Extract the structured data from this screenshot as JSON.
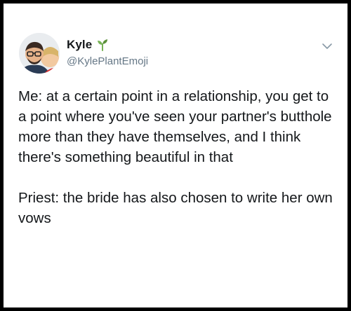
{
  "author": {
    "display_name": "Kyle",
    "handle": "@KylePlantEmoji",
    "verified_badge_icon": "seedling-emoji-icon",
    "avatar_icon": "avatar"
  },
  "menu": {
    "icon": "chevron-down-icon"
  },
  "tweet": {
    "paragraphs": [
      "Me: at a certain point in a relationship, you get to a point where you've seen your partner's butthole more than they have themselves, and I think there's something beautiful in that",
      "Priest: the bride has also chosen to write her own vows"
    ]
  },
  "colors": {
    "frame_border": "#000000",
    "text_primary": "#14171a",
    "text_secondary": "#657786",
    "seedling_green": "#77b255"
  }
}
